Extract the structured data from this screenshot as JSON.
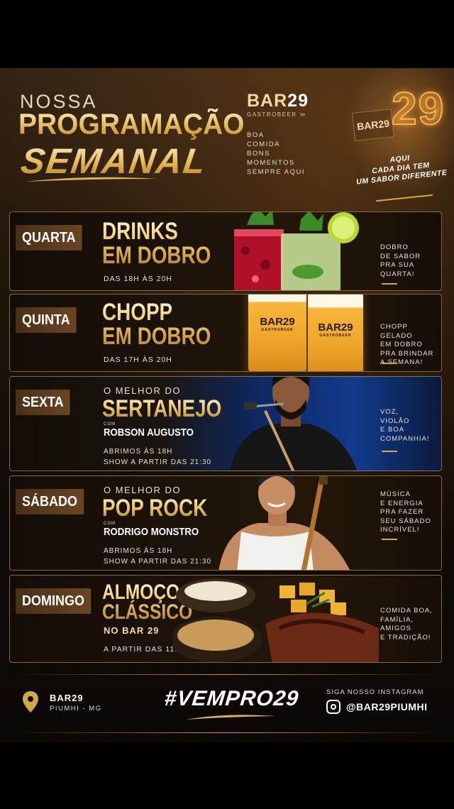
{
  "header": {
    "line1": "NOSSA",
    "line2": "PROGRAMAÇÃO",
    "line3": "SEMANAL"
  },
  "brand": {
    "name_prefix": "BAR",
    "name_number": "29",
    "sub": "GASTROBEER",
    "tagline": [
      "BOA",
      "COMIDA",
      "BONS",
      "MOMENTOS",
      "SEMPRE AQUI"
    ],
    "sign_text": "BAR29",
    "sign_number": "29"
  },
  "slogan": [
    "AQUI",
    "CADA DIA TEM",
    "UM SABOR DIFERENTE"
  ],
  "days": [
    {
      "day": "QUARTA",
      "title": [
        "DRINKS",
        "EM DOBRO"
      ],
      "hours": "DAS 18H ÀS 20H",
      "side": [
        "DOBRO",
        "DE SABOR",
        "PRA SUA",
        "QUARTA!"
      ]
    },
    {
      "day": "QUINTA",
      "title": [
        "CHOPP",
        "EM DOBRO"
      ],
      "hours": "DAS 17H ÀS 20H",
      "glass_logo": "BAR29",
      "glass_sub": "GASTROBEER",
      "side": [
        "CHOPP GELADO",
        "EM DOBRO",
        "PRA BRINDAR",
        "A SEMANA!"
      ]
    },
    {
      "day": "SEXTA",
      "pre": "O MELHOR DO",
      "title": [
        "SERTANEJO"
      ],
      "com": "COM",
      "artist": "ROBSON AUGUSTO",
      "times": [
        "ABRIMOS ÀS 18H",
        "SHOW A PARTIR DAS 21:30"
      ],
      "side": [
        "VOZ,",
        "VIOLÃO",
        "E BOA",
        "COMPANHIA!"
      ]
    },
    {
      "day": "SÁBADO",
      "pre": "O MELHOR DO",
      "title": [
        "POP ROCK"
      ],
      "com": "COM",
      "artist": "RODRIGO MONSTRO",
      "times": [
        "ABRIMOS ÀS 18H",
        "SHOW A PARTIR DAS 21:30"
      ],
      "side": [
        "MÚSICA",
        "E ENERGIA",
        "PRA FAZER",
        "SEU SÁBADO",
        "INCRÍVEL!"
      ]
    },
    {
      "day": "DOMINGO",
      "title": [
        "ALMOÇO",
        "CLÁSSICO"
      ],
      "no": "NO BAR 29",
      "hours": "A PARTIR DAS 11H",
      "side": [
        "COMIDA BOA,",
        "FAMÍLIA,",
        "AMIGOS",
        "E TRADIÇÃO!"
      ]
    }
  ],
  "footer": {
    "location_name": "BAR29",
    "location_city": "PIUMHI - MG",
    "hashtag": "#VEMPRO29",
    "instagram_label": "SIGA NOSSO INSTAGRAM",
    "instagram_handle": "@BAR29PIUMHI"
  },
  "colors": {
    "gold": "#e6b655",
    "dark_bg": "#140d07",
    "day_badge": "#5a3a1c"
  }
}
